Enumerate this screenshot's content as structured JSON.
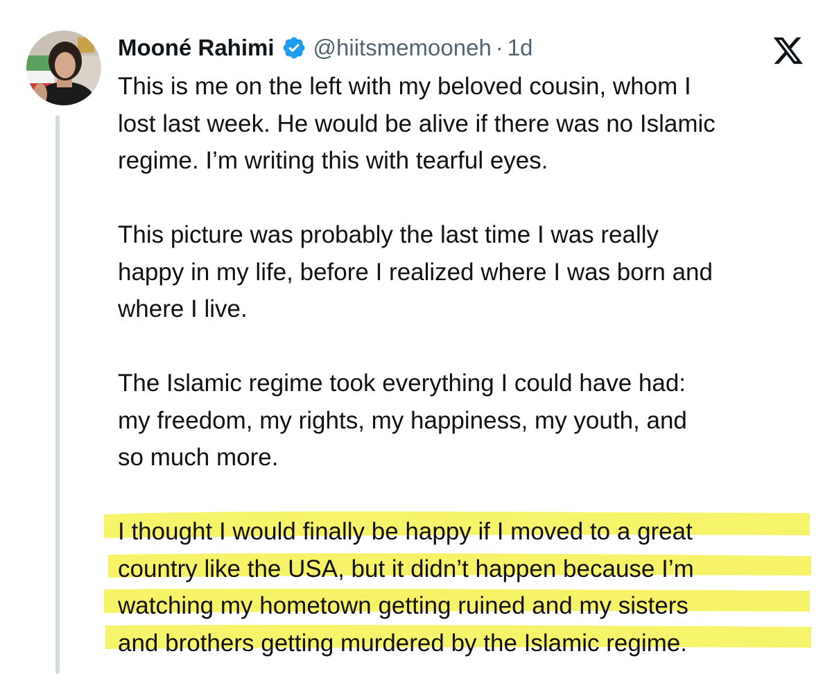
{
  "author": {
    "display_name": "Mooné Rahimi",
    "handle": "@hiitsmemooneh",
    "separator": "·",
    "time": "1d",
    "verified_icon": "verified-badge-icon",
    "avatar_icon": "profile-avatar"
  },
  "brand": {
    "logo_icon": "x-logo-icon"
  },
  "colors": {
    "verified": "#1d9bf0",
    "highlight": "#f5f250",
    "thread_line": "#cfd9de",
    "secondary_text": "#536471"
  },
  "tweet": {
    "paragraphs": [
      {
        "lines": [
          "This is me on the left with my beloved cousin, whom I",
          "lost last week. He would be alive if there was no Islamic",
          "regime. I’m writing this with tearful eyes."
        ]
      },
      {
        "lines": [
          "This picture was probably the last time I was really",
          "happy in my life, before I realized where I was born and",
          "where I live."
        ]
      },
      {
        "lines": [
          "The Islamic regime took everything I could have had:",
          "my freedom, my rights, my happiness, my youth, and",
          "so much more."
        ]
      },
      {
        "highlighted": true,
        "lines": [
          "I thought I would finally be happy if I moved to a great",
          "country like the USA, but it didn’t happen because I’m",
          "watching my hometown getting ruined and my sisters",
          "and brothers getting murdered by the Islamic regime."
        ]
      }
    ]
  }
}
